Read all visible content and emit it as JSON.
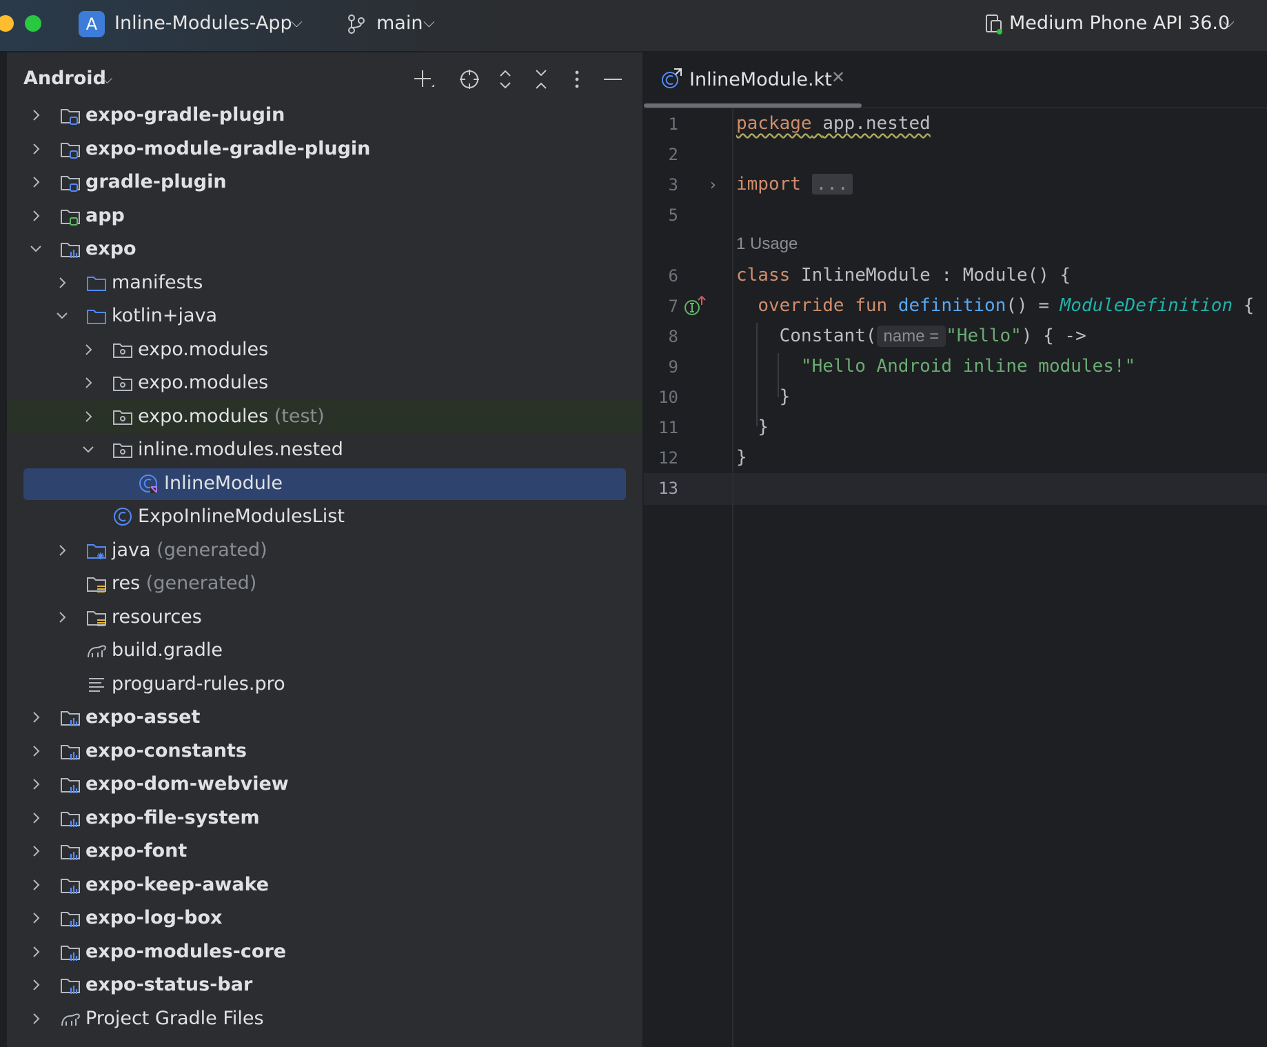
{
  "titlebar": {
    "project_initial": "A",
    "project_name": "Inline-Modules-App",
    "branch": "main",
    "device": "Medium Phone API 36.0"
  },
  "project_panel": {
    "view_name": "Android",
    "tree": [
      {
        "label": "expo-gradle-plugin",
        "suffix": "",
        "depth": 0,
        "expander": "collapsed",
        "icon": "module-folder-icon",
        "bold": true
      },
      {
        "label": "expo-module-gradle-plugin",
        "suffix": "",
        "depth": 0,
        "expander": "collapsed",
        "icon": "module-folder-icon",
        "bold": true
      },
      {
        "label": "gradle-plugin",
        "suffix": "",
        "depth": 0,
        "expander": "collapsed",
        "icon": "module-folder-icon",
        "bold": true
      },
      {
        "label": "app",
        "suffix": "",
        "depth": 0,
        "expander": "collapsed",
        "icon": "app-module-folder-icon",
        "bold": true
      },
      {
        "label": "expo",
        "suffix": "",
        "depth": 0,
        "expander": "expanded",
        "icon": "library-module-folder-icon",
        "bold": true
      },
      {
        "label": "manifests",
        "suffix": "",
        "depth": 1,
        "expander": "collapsed",
        "icon": "folder-icon",
        "bold": false
      },
      {
        "label": "kotlin+java",
        "suffix": "",
        "depth": 1,
        "expander": "expanded",
        "icon": "folder-icon",
        "bold": false
      },
      {
        "label": "expo.modules",
        "suffix": "",
        "depth": 2,
        "expander": "collapsed",
        "icon": "package-icon",
        "bold": false
      },
      {
        "label": "expo.modules",
        "suffix": "",
        "depth": 2,
        "expander": "collapsed",
        "icon": "package-icon",
        "bold": false
      },
      {
        "label": "expo.modules",
        "suffix": "(test)",
        "depth": 2,
        "expander": "collapsed",
        "icon": "package-icon",
        "bold": false,
        "highlight": "green"
      },
      {
        "label": "inline.modules.nested",
        "suffix": "",
        "depth": 2,
        "expander": "expanded",
        "icon": "package-icon",
        "bold": false
      },
      {
        "label": "InlineModule",
        "suffix": "",
        "depth": 3,
        "expander": "none",
        "icon": "kotlin-class-icon",
        "bold": false,
        "selected": true
      },
      {
        "label": "ExpoInlineModulesList",
        "suffix": "",
        "depth": 2,
        "expander": "none",
        "icon": "class-icon",
        "bold": false
      },
      {
        "label": "java",
        "suffix": "(generated)",
        "depth": 1,
        "expander": "collapsed",
        "icon": "generated-folder-icon",
        "bold": false
      },
      {
        "label": "res",
        "suffix": "(generated)",
        "depth": 1,
        "expander": "none",
        "icon": "resource-folder-icon",
        "bold": false
      },
      {
        "label": "resources",
        "suffix": "",
        "depth": 1,
        "expander": "collapsed",
        "icon": "resource-folder-icon",
        "bold": false
      },
      {
        "label": "build.gradle",
        "suffix": "",
        "depth": 1,
        "expander": "none",
        "icon": "gradle-icon",
        "bold": false
      },
      {
        "label": "proguard-rules.pro",
        "suffix": "",
        "depth": 1,
        "expander": "none",
        "icon": "text-file-icon",
        "bold": false
      },
      {
        "label": "expo-asset",
        "suffix": "",
        "depth": 0,
        "expander": "collapsed",
        "icon": "library-module-folder-icon",
        "bold": true
      },
      {
        "label": "expo-constants",
        "suffix": "",
        "depth": 0,
        "expander": "collapsed",
        "icon": "library-module-folder-icon",
        "bold": true
      },
      {
        "label": "expo-dom-webview",
        "suffix": "",
        "depth": 0,
        "expander": "collapsed",
        "icon": "library-module-folder-icon",
        "bold": true
      },
      {
        "label": "expo-file-system",
        "suffix": "",
        "depth": 0,
        "expander": "collapsed",
        "icon": "library-module-folder-icon",
        "bold": true
      },
      {
        "label": "expo-font",
        "suffix": "",
        "depth": 0,
        "expander": "collapsed",
        "icon": "library-module-folder-icon",
        "bold": true
      },
      {
        "label": "expo-keep-awake",
        "suffix": "",
        "depth": 0,
        "expander": "collapsed",
        "icon": "library-module-folder-icon",
        "bold": true
      },
      {
        "label": "expo-log-box",
        "suffix": "",
        "depth": 0,
        "expander": "collapsed",
        "icon": "library-module-folder-icon",
        "bold": true
      },
      {
        "label": "expo-modules-core",
        "suffix": "",
        "depth": 0,
        "expander": "collapsed",
        "icon": "library-module-folder-icon",
        "bold": true
      },
      {
        "label": "expo-status-bar",
        "suffix": "",
        "depth": 0,
        "expander": "collapsed",
        "icon": "library-module-folder-icon",
        "bold": true
      },
      {
        "label": "Project Gradle Files",
        "suffix": "",
        "depth": 0,
        "expander": "collapsed",
        "icon": "gradle-icon",
        "bold": false
      }
    ]
  },
  "editor": {
    "tab_label": "InlineModule.kt",
    "line_numbers": [
      "1",
      "2",
      "3",
      "5",
      "6",
      "7",
      "8",
      "9",
      "10",
      "11",
      "12",
      "13"
    ],
    "usage_hint": "1 Usage",
    "code": {
      "l1_kw": "package",
      "l1_rest": "app.nested",
      "l3_kw": "import",
      "l3_fold": "...",
      "l6_kw": "class",
      "l6_rest": " InlineModule : Module() {",
      "l7_kw": "override fun",
      "l7_fn": "definition",
      "l7_mid": "() = ",
      "l7_type": "ModuleDefinition",
      "l7_end": " {",
      "l8_a": "Constant(",
      "l8_hint": "name =",
      "l8_str": "\"Hello\"",
      "l8_end": ") { ->",
      "l9_str": "\"Hello Android inline modules!\"",
      "l10": "}",
      "l11": "}",
      "l12": "}"
    }
  },
  "colors": {
    "accent": "#2e436e",
    "keyword": "#cf8e6d",
    "function": "#56a8f5",
    "string": "#6aab73",
    "type_italic": "#20b2aa"
  }
}
